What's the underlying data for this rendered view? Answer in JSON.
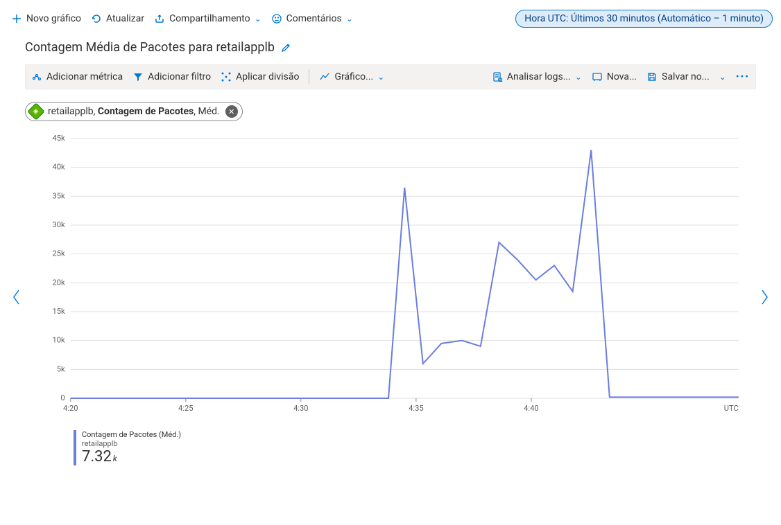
{
  "toolbar": {
    "new_chart": "Novo gráfico",
    "refresh": "Atualizar",
    "share": "Compartilhamento",
    "comments": "Comentários",
    "time_range": "Hora UTC: Últimos 30 minutos (Automático – 1 minuto)"
  },
  "title": "Contagem Média de Pacotes para retailapplb",
  "chart_toolbar": {
    "add_metric": "Adicionar métrica",
    "add_filter": "Adicionar filtro",
    "apply_split": "Aplicar divisão",
    "chart_type": "Gráfico...",
    "analyze_logs": "Analisar logs...",
    "new_alert": "Nova...",
    "save_to": "Salvar no..."
  },
  "metric_chip": {
    "resource": "retailapplb",
    "metric": "Contagem de Pacotes",
    "aggregation": "Méd."
  },
  "legend": {
    "line1": "Contagem de Pacotes (Méd.)",
    "line2": "retailapplb",
    "value": "7.32",
    "unit": "k"
  },
  "chart_data": {
    "type": "line",
    "title": "Contagem Média de Pacotes para retailapplb",
    "ylabel": "",
    "xlabel": "",
    "ylim": [
      0,
      45000
    ],
    "y_ticks": [
      0,
      5000,
      10000,
      15000,
      20000,
      25000,
      30000,
      35000,
      40000,
      45000
    ],
    "y_tick_labels": [
      "0",
      "5k",
      "10k",
      "15k",
      "20k",
      "25k",
      "30k",
      "35k",
      "40k",
      "45k"
    ],
    "x_ticks": [
      "4:20",
      "4:25",
      "4:30",
      "4:35",
      "4:40"
    ],
    "x_unit_label": "UTC",
    "series": [
      {
        "name": "Contagem de Pacotes (Méd.) — retailapplb",
        "color": "#6b7ee0",
        "x": [
          20.0,
          21,
          22,
          23,
          24,
          25,
          26,
          27,
          28,
          29,
          30,
          31,
          32,
          33,
          33.8,
          34.5,
          35.3,
          36.1,
          37.0,
          37.8,
          38.6,
          39.4,
          40.2,
          41.0,
          41.8,
          42.6,
          43.4,
          44.2,
          45.0,
          46.0,
          47.0,
          48.0,
          49.0
        ],
        "values": [
          0,
          0,
          0,
          0,
          0,
          0,
          0,
          0,
          0,
          0,
          0,
          0,
          0,
          0,
          0,
          36500,
          6000,
          9500,
          10000,
          9000,
          27000,
          24000,
          20500,
          23000,
          18500,
          43000,
          200,
          200,
          200,
          200,
          200,
          200,
          200
        ]
      }
    ],
    "x_range_minutes": [
      20,
      49
    ]
  }
}
